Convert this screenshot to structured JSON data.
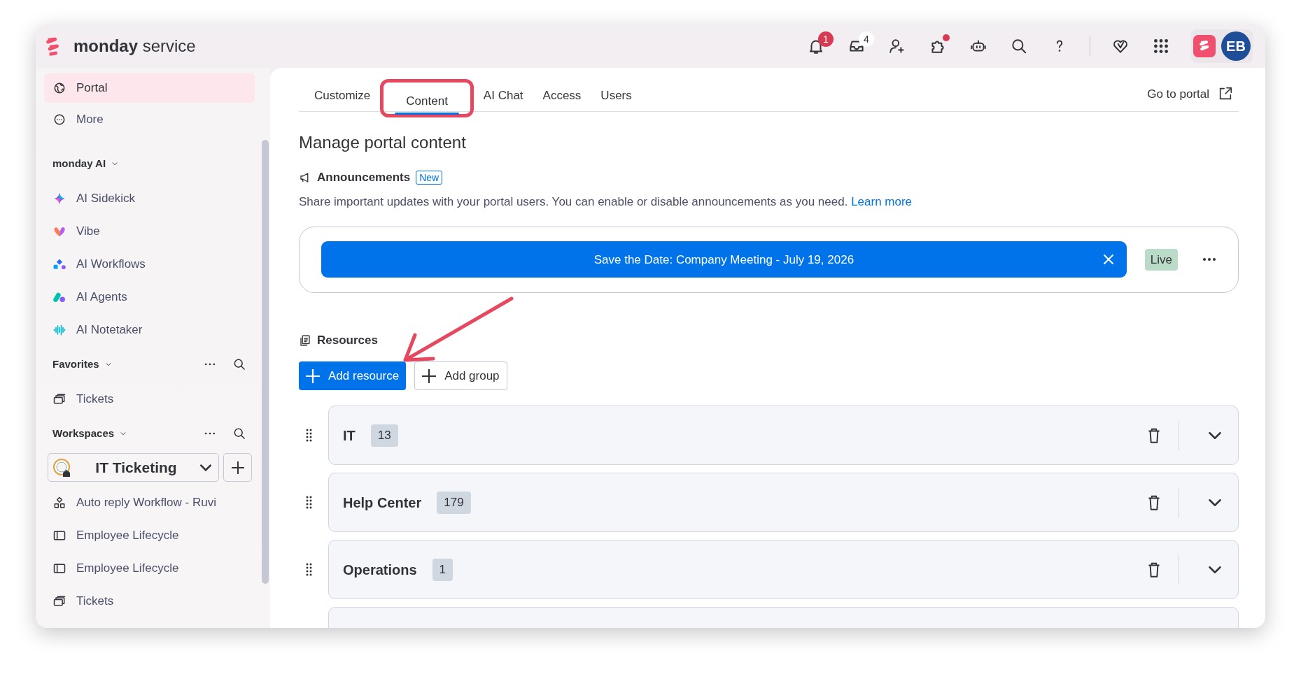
{
  "app": {
    "brand_bold": "monday",
    "brand_light": "service"
  },
  "topbar": {
    "icons": [
      {
        "kind": "bell",
        "badge": {
          "text": "1",
          "kind": "alert"
        }
      },
      {
        "kind": "inbox",
        "badge": {
          "text": "4",
          "kind": "count"
        }
      },
      {
        "kind": "invite"
      },
      {
        "kind": "puzzle",
        "dot": true
      },
      {
        "kind": "robot"
      },
      {
        "kind": "search"
      },
      {
        "kind": "help"
      },
      {
        "kind": "divider"
      },
      {
        "kind": "heart"
      },
      {
        "kind": "apps"
      }
    ],
    "avatar": {
      "initials": "EB"
    }
  },
  "sidebar": {
    "items": [
      {
        "label": "Portal",
        "kind": "globe",
        "selected": true
      },
      {
        "label": "More",
        "kind": "more",
        "selected": false
      }
    ],
    "sections": [
      {
        "title": "monday AI",
        "actions": false,
        "items": [
          {
            "label": "AI Sidekick",
            "kind": "sparkle",
            "selected": false
          },
          {
            "label": "Vibe",
            "kind": "vibe",
            "selected": false
          },
          {
            "label": "AI Workflows",
            "kind": "workflows",
            "selected": false
          },
          {
            "label": "AI Agents",
            "kind": "agents",
            "selected": false
          },
          {
            "label": "AI Notetaker",
            "kind": "wave",
            "selected": false
          }
        ]
      },
      {
        "title": "Favorites",
        "actions": true,
        "items": [
          {
            "label": "Tickets",
            "kind": "boards",
            "selected": false
          }
        ]
      },
      {
        "title": "Workspaces",
        "actions": true,
        "workspace": "IT Ticketing",
        "items": [
          {
            "label": "Auto reply Workflow - Ruvi",
            "kind": "flow",
            "selected": false
          },
          {
            "label": "Employee Lifecycle",
            "kind": "panel",
            "selected": false
          },
          {
            "label": "Employee Lifecycle",
            "kind": "panel",
            "selected": false
          },
          {
            "label": "Tickets",
            "kind": "boards",
            "selected": false
          }
        ]
      }
    ]
  },
  "tabs": [
    {
      "label": "Customize",
      "selected": false,
      "highlighted": false
    },
    {
      "label": "Content",
      "selected": true,
      "highlighted": true
    },
    {
      "label": "AI Chat",
      "selected": false,
      "highlighted": false
    },
    {
      "label": "Access",
      "selected": false,
      "highlighted": false
    },
    {
      "label": "Users",
      "selected": false,
      "highlighted": false
    }
  ],
  "portal_link": "Go to portal",
  "main": {
    "title": "Manage portal content",
    "announcements": {
      "title": "Announcements",
      "badge": "New",
      "description": "Share important updates with your portal users. You can enable or disable announcements as you need.",
      "link": "Learn more",
      "items": [
        {
          "text": "Save the Date: Company Meeting - July 19, 2026",
          "status": "Live"
        }
      ]
    },
    "resources": {
      "title": "Resources",
      "pointer_arrow": true,
      "buttons": [
        {
          "label": "Add resource",
          "kind": "primary"
        },
        {
          "label": "Add group",
          "kind": "secondary"
        }
      ],
      "groups": [
        {
          "name": "IT",
          "count": "13"
        },
        {
          "name": "Help Center",
          "count": "179"
        },
        {
          "name": "Operations",
          "count": "1"
        },
        {
          "kind": "partial"
        }
      ]
    }
  }
}
